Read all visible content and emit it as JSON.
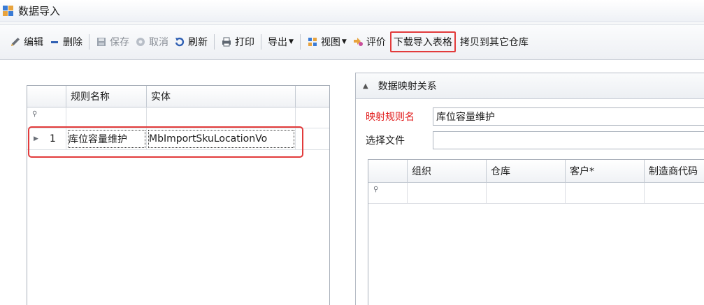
{
  "window": {
    "title": "数据导入"
  },
  "toolbar": {
    "edit": "编辑",
    "delete": "删除",
    "save": "保存",
    "cancel": "取消",
    "refresh": "刷新",
    "print": "打印",
    "export": "导出",
    "view": "视图",
    "rate": "评价",
    "download_template": "下载导入表格",
    "copy_to_other": "拷贝到其它仓库"
  },
  "rules_grid": {
    "columns": [
      "规则名称",
      "实体"
    ],
    "rows": [
      {
        "index": "1",
        "name": "库位容量维护",
        "entity": "MbImportSkuLocationVo"
      }
    ]
  },
  "mapping_panel": {
    "title": "数据映射关系",
    "rule_name_label": "映射规则名",
    "rule_name_value": "库位容量维护",
    "file_label": "选择文件",
    "file_value": "",
    "columns": [
      "组织",
      "仓库",
      "客户*",
      "制造商代码"
    ]
  },
  "colors": {
    "highlight": "#e23b3b",
    "required_label": "#e11c1c"
  }
}
